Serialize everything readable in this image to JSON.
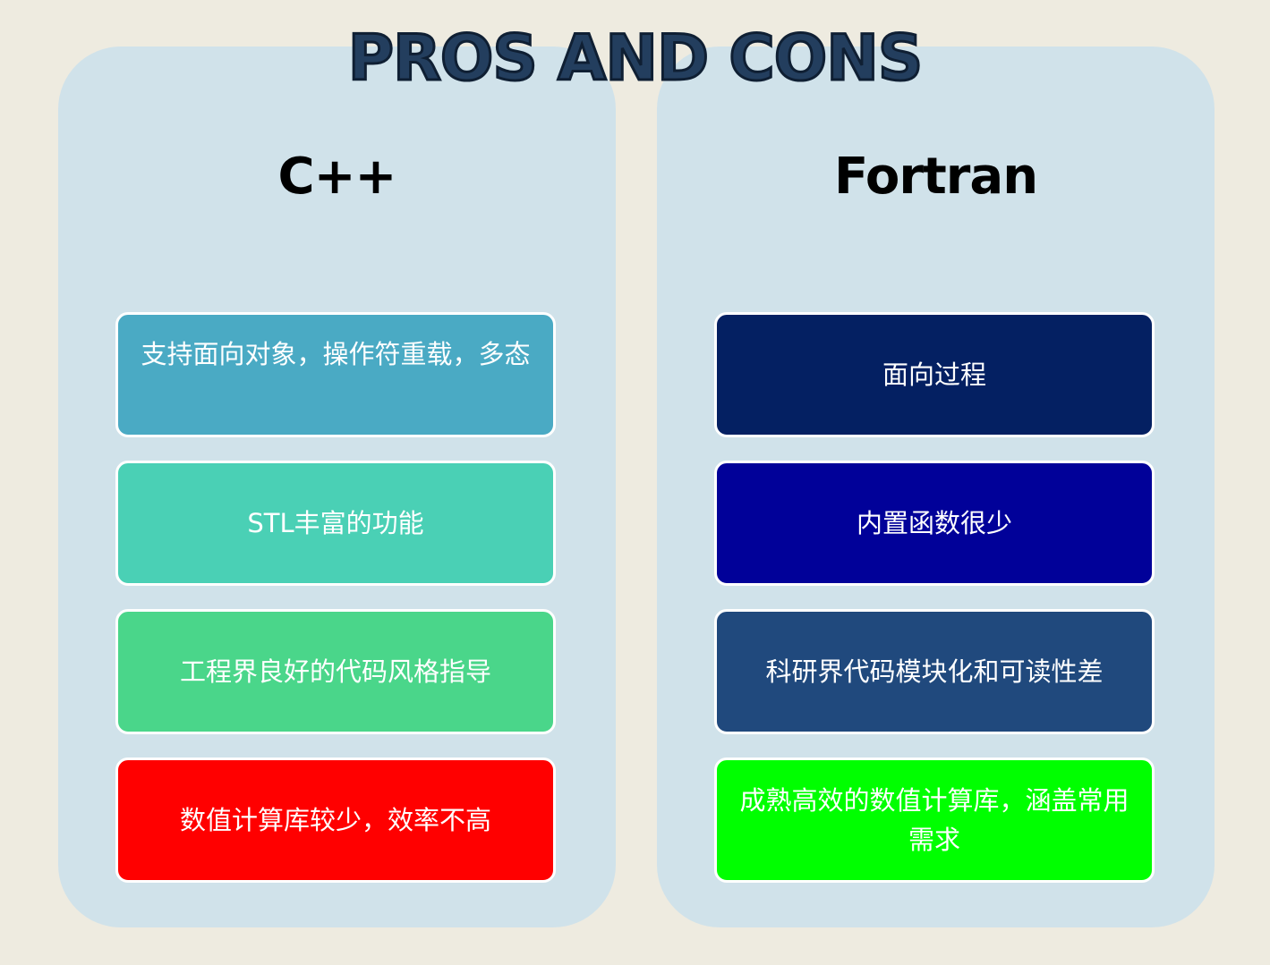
{
  "title": "PROS AND CONS",
  "columns": [
    {
      "title": "C++",
      "items": [
        {
          "text": "支持面向对象，操作符重载，多态",
          "color": "#4aaac4"
        },
        {
          "text": "STL丰富的功能",
          "color": "#4ad0b5"
        },
        {
          "text": "工程界良好的代码风格指导",
          "color": "#4ad68a"
        },
        {
          "text": "数值计算库较少，效率不高",
          "color": "#ff0000"
        }
      ]
    },
    {
      "title": "Fortran",
      "items": [
        {
          "text": "面向过程",
          "color": "#042062"
        },
        {
          "text": "内置函数很少",
          "color": "#010199"
        },
        {
          "text": "科研界代码模块化和可读性差",
          "color": "#20497d"
        },
        {
          "text": "成熟高效的数值计算库，涵盖常用需求",
          "color": "#00ff00"
        }
      ]
    }
  ]
}
